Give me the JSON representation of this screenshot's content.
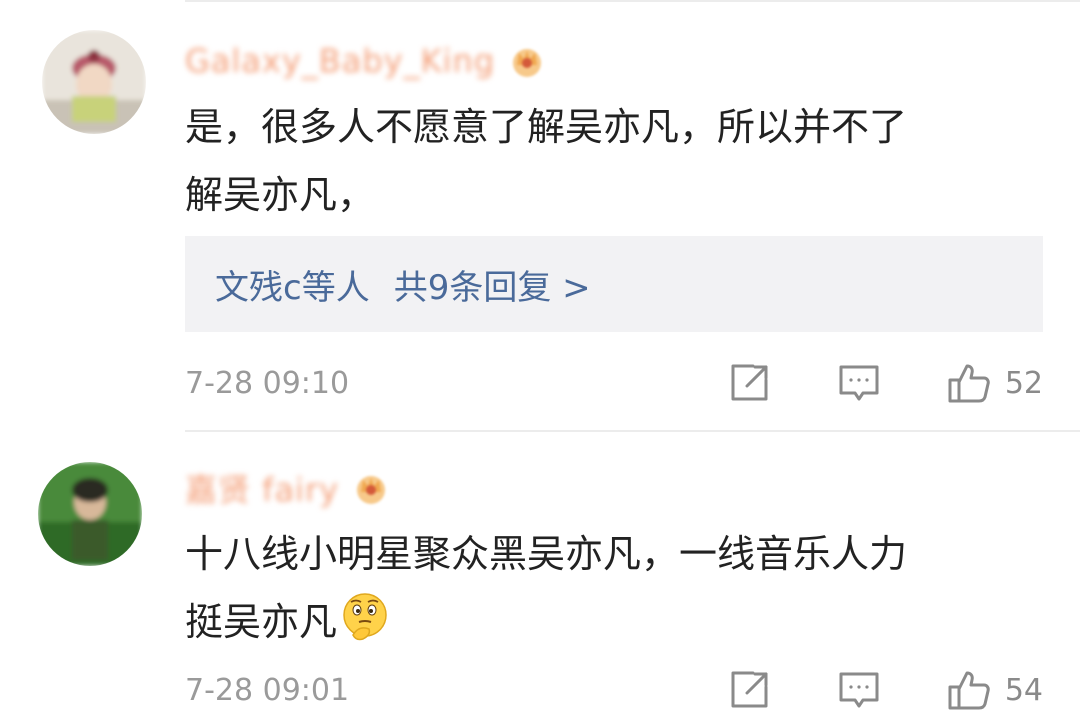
{
  "comments": [
    {
      "username": "Galaxy_Baby_King",
      "badge_icon": "vip-crown-icon",
      "content_lines": [
        "是，很多人不愿意了解吴亦凡，所以并不了",
        "解吴亦凡，"
      ],
      "replies": {
        "label": "文残c等人",
        "count_label": "共9条回复 >"
      },
      "timestamp": "7-28 09:10",
      "like_count": "52"
    },
    {
      "username": "嘉贤 fairy",
      "badge_icon": "vip-crown-icon",
      "content_lines": [
        "十八线小明星聚众黑吴亦凡，一线音乐人力",
        "挺吴亦凡"
      ],
      "content_emoji": "thinking-face-emoji",
      "timestamp": "7-28 09:01",
      "like_count": "54"
    }
  ],
  "colors": {
    "username": "#f4a07a",
    "reply_link": "#4a6a9a",
    "reply_bg": "#f2f2f4",
    "meta_text": "#9a9a9a"
  }
}
